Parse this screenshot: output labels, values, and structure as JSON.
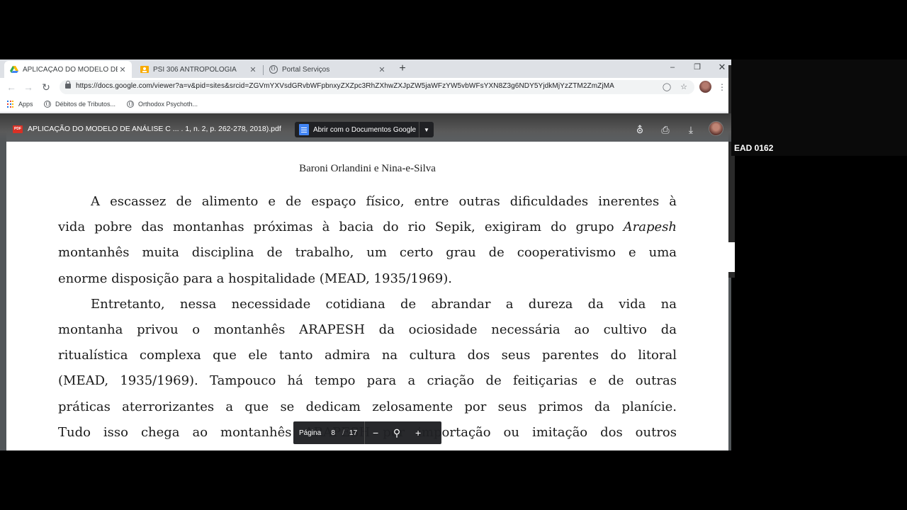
{
  "browser": {
    "tabs": [
      {
        "label": "APLICAÇÃO DO MODELO DE ANÁ",
        "icon": "google-drive-icon",
        "active": true
      },
      {
        "label": "PSI 306 ANTROPOLOGIA",
        "icon": "classroom-icon",
        "active": false
      },
      {
        "label": "Portal Serviços",
        "icon": "globe-icon",
        "active": false
      }
    ],
    "url": "https://docs.google.com/viewer?a=v&pid=sites&srcid=ZGVmYXVsdGRvbWFpbnxyZXZpc3RhZXhwZXJpZW5jaWFzYW5vbWFsYXN8Z3g6NDY5YjdkMjYzZTM2ZmZjMA",
    "bookmarks": [
      {
        "label": "Apps",
        "icon": "apps-grid-icon"
      },
      {
        "label": "Débitos de Tributos...",
        "icon": "globe-icon"
      },
      {
        "label": "Orthodox Psychoth...",
        "icon": "globe-icon"
      }
    ]
  },
  "viewer": {
    "badge": "PDF",
    "doc_title": "APLICAÇÃO DO MODELO DE ANÁLISE C ... . 1, n. 2, p. 262-278, 2018).pdf",
    "open_with_label": "Abrir com o Documentos Google"
  },
  "page": {
    "running_head": "Baroni Orlandini e Nina-e-Silva",
    "paragraphs": [
      {
        "lines": [
          "A escassez de alimento e de espaço físico, entre outras dificuldades inerentes à",
          "vida pobre das montanhas próximas à bacia do rio Sepik, exigiram do grupo Arapesh",
          "montanhês muita disciplina de trabalho, um certo grau de cooperativismo e uma",
          "enorme disposição para a hospitalidade (MEAD, 1935/1969)."
        ]
      },
      {
        "lines": [
          "Entretanto, nessa necessidade cotidiana de abrandar a dureza da vida na",
          "montanha privou o montanhês ARAPESH da ociosidade necessária ao cultivo da",
          "ritualística complexa que ele tanto admira na cultura dos seus parentes do litoral",
          "(MEAD, 1935/1969). Tampouco há tempo para a criação de feitiçarias e de outras",
          "práticas aterrorizantes a que se dedicam zelosamente por seus primos da planície.",
          "Tudo isso chega ao montanhês ARAPESH por importação ou imitação dos outros"
        ]
      }
    ]
  },
  "page_control": {
    "label": "Página",
    "current": "8",
    "separator": "/",
    "total": "17"
  },
  "overlay": {
    "camera_label": "EAD 0162"
  }
}
